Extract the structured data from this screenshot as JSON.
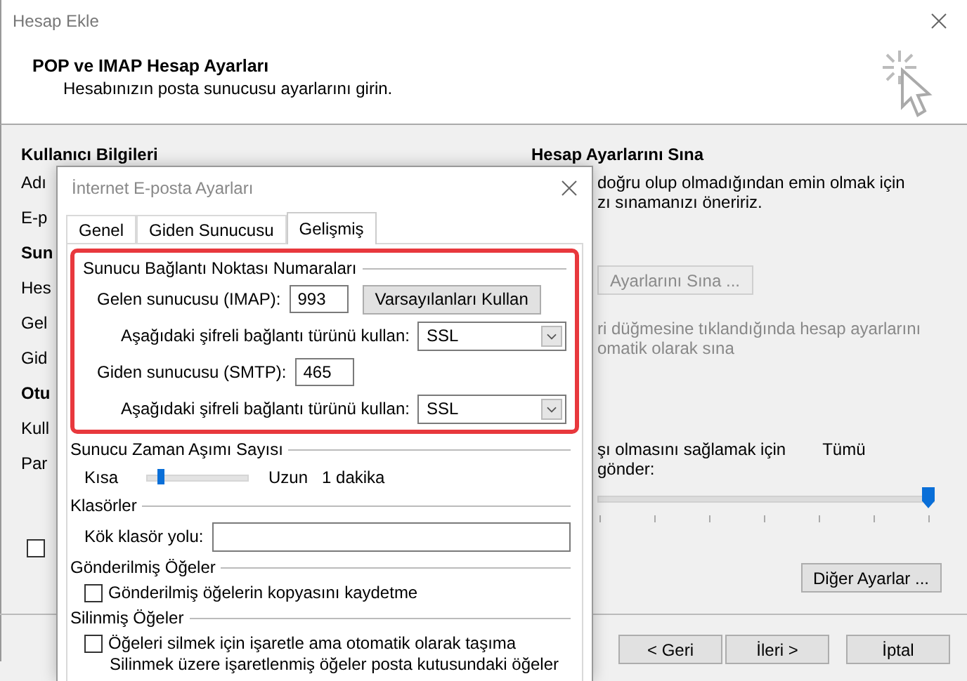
{
  "window": {
    "title": "Hesap Ekle"
  },
  "header": {
    "title": "POP ve IMAP Hesap Ayarları",
    "subtitle": "Hesabınızın posta sunucusu ayarlarını girin."
  },
  "user_section": {
    "heading": "Kullanıcı Bilgileri",
    "labels": [
      {
        "text": "Adı",
        "kind": "label"
      },
      {
        "text": "E-p",
        "kind": "label"
      },
      {
        "text": "Sun",
        "kind": "heading"
      },
      {
        "text": "Hes",
        "kind": "label"
      },
      {
        "text": "Gel",
        "kind": "label"
      },
      {
        "text": "Gid",
        "kind": "label"
      },
      {
        "text": "Otu",
        "kind": "heading"
      },
      {
        "text": "Kull",
        "kind": "label"
      },
      {
        "text": "Par",
        "kind": "label"
      }
    ],
    "checkbox": {
      "checked": false
    }
  },
  "test_section": {
    "heading": "Hesap Ayarlarını Sına",
    "lines": [
      "doğru olup olmadığından emin olmak için",
      "zı sınamanızı öneririz."
    ],
    "test_button": {
      "label": "Ayarlarını Sına ...",
      "disabled": true
    },
    "auto_test": {
      "lines": [
        "ri düğmesine tıklandığında hesap ayarlarını",
        "omatik olarak sına"
      ],
      "disabled": true
    },
    "download_text": "şı olmasını sağlamak için",
    "download_value": "Tümü",
    "download_text_2": "gönder:",
    "download_slider": {
      "level": 1
    },
    "more_settings_button": "Diğer Ayarlar ..."
  },
  "buttons": [
    {
      "label": "< Geri"
    },
    {
      "label": "İleri >"
    },
    {
      "label": "İptal"
    }
  ],
  "dialog": {
    "title": "İnternet E-posta Ayarları",
    "tabs": [
      {
        "label": "Genel",
        "selected": false
      },
      {
        "label": "Giden Sunucusu",
        "selected": false
      },
      {
        "label": "Gelişmiş",
        "selected": true
      }
    ],
    "ports": {
      "heading": "Sunucu Bağlantı Noktası Numaraları",
      "incoming_label": "Gelen sunucusu (IMAP):",
      "incoming_value": "993",
      "defaults_button": "Varsayılanları Kullan",
      "incoming_encryption_label": "Aşağıdaki şifreli bağlantı türünü kullan:",
      "incoming_encryption": "SSL",
      "outgoing_label": "Giden sunucusu (SMTP):",
      "outgoing_value": "465",
      "outgoing_encryption_label": "Aşağıdaki şifreli bağlantı türünü kullan:",
      "outgoing_encryption": "SSL"
    },
    "timeout": {
      "heading": "Sunucu Zaman Aşımı Sayısı",
      "min_label": "Kısa",
      "max_label": "Uzun",
      "level": 0.12,
      "value": "1 dakika"
    },
    "folders": {
      "heading": "Klasörler",
      "root_label": "Kök klasör yolu:"
    },
    "sent": {
      "heading": "Gönderilmiş Öğeler",
      "checkbox": {
        "label": "Gönderilmiş öğelerin kopyasını kaydetme",
        "checked": false
      }
    },
    "deleted": {
      "heading": "Silinmiş Öğeler",
      "checkbox": {
        "label": "Öğeleri silmek için işaretle ama otomatik olarak taşıma",
        "checked": false
      },
      "note": "Silinmek üzere işaretlenmiş öğeler posta kutusundaki öğeler"
    }
  }
}
